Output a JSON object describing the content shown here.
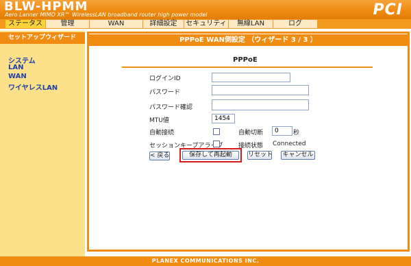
{
  "header": {
    "product_title": "BLW-HPMM",
    "product_subtitle": "Aero Lanner MIMO XR™ WirelessLAN broadband router high power model",
    "brand_logo": "PCI"
  },
  "nav": {
    "tabs": [
      {
        "label": "ステータス"
      },
      {
        "label": "管理"
      },
      {
        "label": "WAN"
      },
      {
        "label": "詳細設定"
      },
      {
        "label": "セキュリティ"
      },
      {
        "label": "無線LAN"
      },
      {
        "label": "ログ"
      }
    ]
  },
  "sidebar": {
    "title": "セットアップウィザード",
    "items": [
      {
        "label": "システム"
      },
      {
        "label": "LAN"
      },
      {
        "label": "WAN"
      },
      {
        "label": "ワイヤレスLAN"
      }
    ]
  },
  "panel": {
    "title": "PPPoE WAN側設定 （ウィザード 3 / 3 ）",
    "section_heading": "PPPoE"
  },
  "form": {
    "login_id_label": "ログインID",
    "login_id_value": "",
    "password_label": "パスワード",
    "password_value": "",
    "password_confirm_label": "パスワード確認",
    "password_confirm_value": "",
    "mtu_label": "MTU値",
    "mtu_value": "1454",
    "auto_connect_label": "自動接続",
    "auto_disconnect_label": "自動切断",
    "auto_disconnect_value": "0",
    "seconds_unit": "秒",
    "keepalive_label": "セッションキープアライブ",
    "connection_status_label": "接続状態",
    "connection_status_value": "Connected"
  },
  "buttons": {
    "back": "< 戻る",
    "save_restart": "保存して再起動",
    "reset": "リセット",
    "cancel": "キャンセル"
  },
  "footer": {
    "text": "PLANEX COMMUNICATIONS INC."
  }
}
